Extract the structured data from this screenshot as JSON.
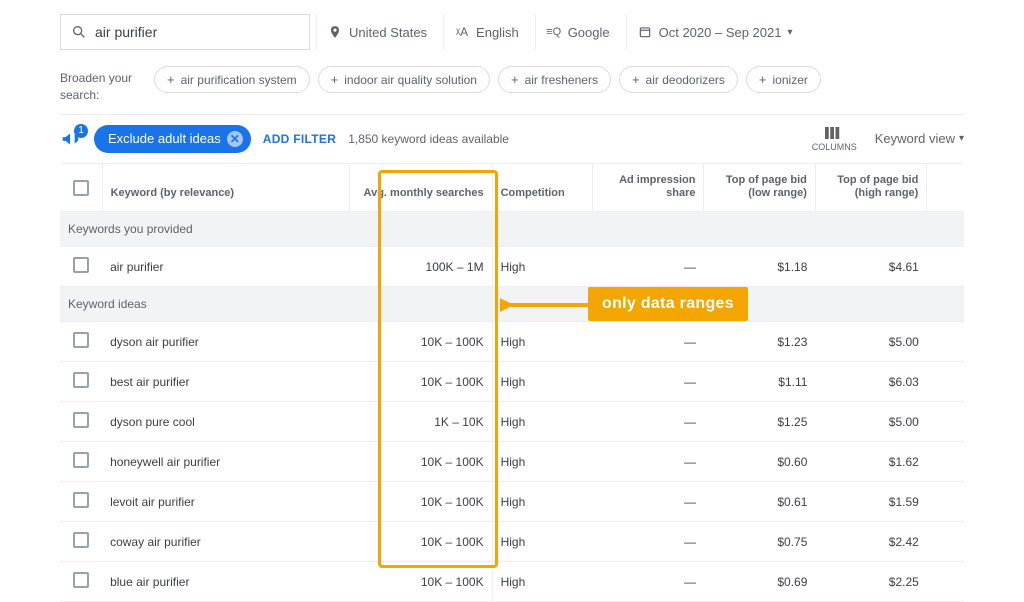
{
  "search": {
    "query": "air purifier"
  },
  "location": "United States",
  "language": "English",
  "network": "Google",
  "date_range": "Oct 2020 – Sep 2021",
  "broaden_label": "Broaden your search:",
  "chips": [
    "air purification system",
    "indoor air quality solution",
    "air fresheners",
    "air deodorizers",
    "ionizer"
  ],
  "toolbar": {
    "badge": "1",
    "exclude_label": "Exclude adult ideas",
    "add_filter": "ADD FILTER",
    "available": "1,850 keyword ideas available",
    "columns_label": "COLUMNS",
    "view_label": "Keyword view"
  },
  "columns": {
    "keyword": "Keyword (by relevance)",
    "avg": "Avg. monthly searches",
    "competition": "Competition",
    "impression": "Ad impression share",
    "bid_low": "Top of page bid (low range)",
    "bid_high": "Top of page bid (high range)"
  },
  "section_provided": "Keywords you provided",
  "section_ideas": "Keyword ideas",
  "rows_provided": [
    {
      "keyword": "air purifier",
      "avg": "100K – 1M",
      "comp": "High",
      "imp": "—",
      "low": "$1.18",
      "high": "$4.61"
    }
  ],
  "rows_ideas": [
    {
      "keyword": "dyson air purifier",
      "avg": "10K – 100K",
      "comp": "High",
      "imp": "—",
      "low": "$1.23",
      "high": "$5.00"
    },
    {
      "keyword": "best air purifier",
      "avg": "10K – 100K",
      "comp": "High",
      "imp": "—",
      "low": "$1.11",
      "high": "$6.03"
    },
    {
      "keyword": "dyson pure cool",
      "avg": "1K – 10K",
      "comp": "High",
      "imp": "—",
      "low": "$1.25",
      "high": "$5.00"
    },
    {
      "keyword": "honeywell air purifier",
      "avg": "10K – 100K",
      "comp": "High",
      "imp": "—",
      "low": "$0.60",
      "high": "$1.62"
    },
    {
      "keyword": "levoit air purifier",
      "avg": "10K – 100K",
      "comp": "High",
      "imp": "—",
      "low": "$0.61",
      "high": "$1.59"
    },
    {
      "keyword": "coway air purifier",
      "avg": "10K – 100K",
      "comp": "High",
      "imp": "—",
      "low": "$0.75",
      "high": "$2.42"
    },
    {
      "keyword": "blue air purifier",
      "avg": "10K – 100K",
      "comp": "High",
      "imp": "—",
      "low": "$0.69",
      "high": "$2.25"
    }
  ],
  "callout": {
    "label": "only data ranges"
  }
}
